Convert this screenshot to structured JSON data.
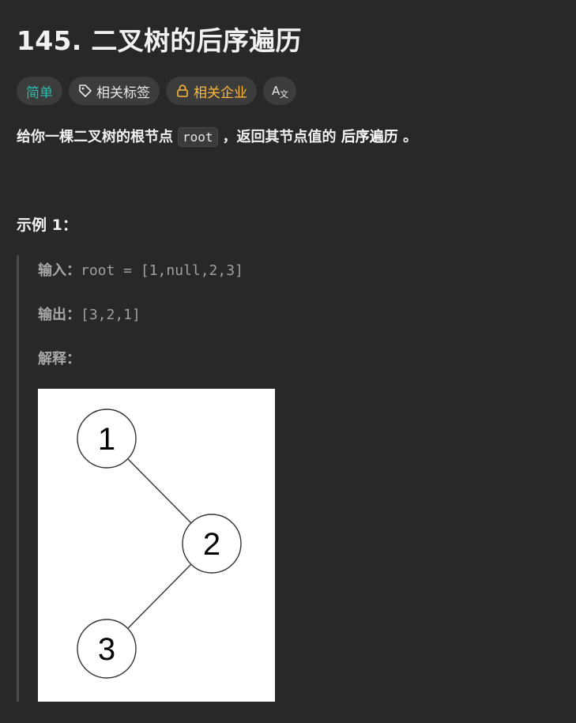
{
  "problem": {
    "title": "145. 二叉树的后序遍历",
    "tags": {
      "difficulty": "简单",
      "related_tags": "相关标签",
      "related_companies": "相关企业",
      "translate": "A文"
    },
    "description": {
      "prefix": "给你一棵二叉树的根节点",
      "code": "root",
      "middle": "，返回其节点值的",
      "emphasis": "后序遍历",
      "suffix": "。"
    },
    "example": {
      "heading": "示例 1：",
      "input_label": "输入：",
      "input_value": "root = [1,null,2,3]",
      "output_label": "输出：",
      "output_value": "[3,2,1]",
      "explain_label": "解释："
    },
    "tree": {
      "nodes": [
        "1",
        "2",
        "3"
      ]
    }
  },
  "colors": {
    "background": "#282828",
    "easy": "#2cbbad",
    "company": "#ffb93b",
    "tag_bg": "#3c3c3c"
  },
  "icons": {
    "tag": "tag-icon",
    "lock": "lock-icon",
    "translate": "translate-icon"
  }
}
